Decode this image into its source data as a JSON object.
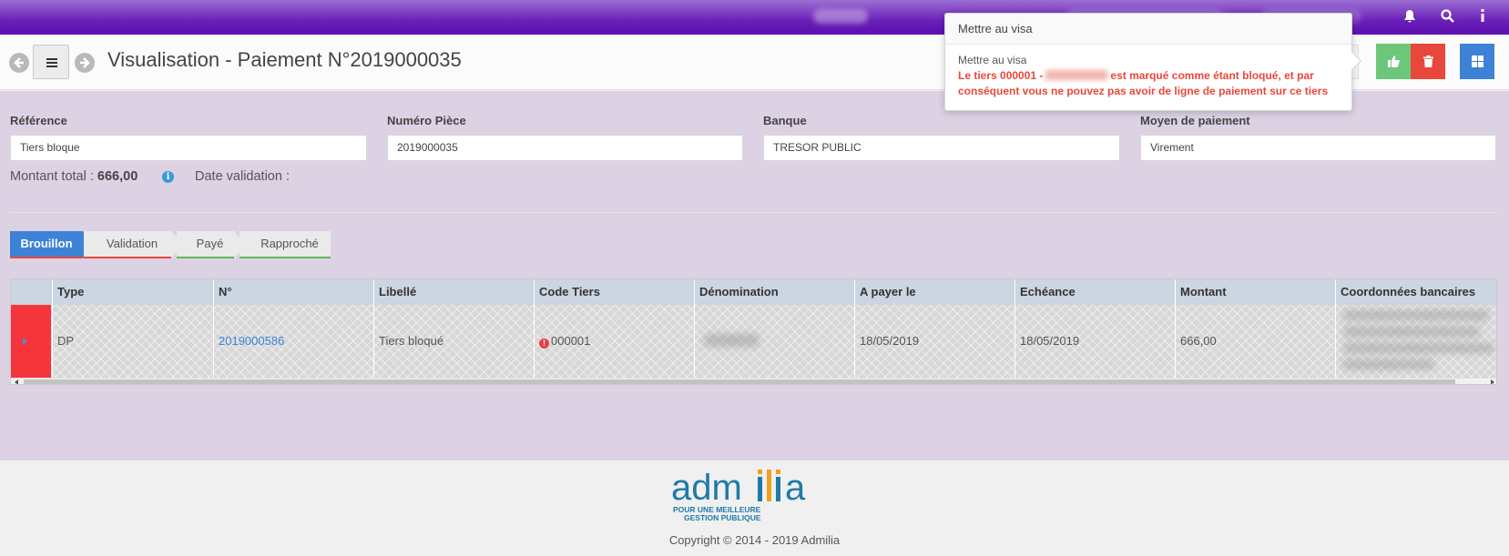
{
  "topbar": {
    "icons": [
      "bell-icon",
      "search-icon",
      "info-icon"
    ]
  },
  "header": {
    "title": "Visualisation - Paiement N°2019000035"
  },
  "popover": {
    "title": "Mettre au visa",
    "subtitle": "Mettre au visa",
    "error_prefix": "Le tiers 000001 -",
    "error_suffix": "est marqué comme étant bloqué, et par conséquent vous ne pouvez pas avoir de ligne de paiement sur ce tiers"
  },
  "form": {
    "reference_label": "Référence",
    "reference_value": "Tiers bloque",
    "numero_label": "Numéro Pièce",
    "numero_value": "2019000035",
    "banque_label": "Banque",
    "banque_value": "TRESOR PUBLIC",
    "moyen_label": "Moyen de paiement",
    "moyen_value": "Virement",
    "montant_label": "Montant total :",
    "montant_value": "666,00",
    "date_label": "Date validation :"
  },
  "steps": [
    {
      "label": "Brouillon",
      "color": "#e8473b"
    },
    {
      "label": "Validation",
      "color": "#e8473b"
    },
    {
      "label": "Payé",
      "color": "#5cb85c"
    },
    {
      "label": "Rapproché",
      "color": "#5cb85c"
    }
  ],
  "table": {
    "columns": [
      "Type",
      "N°",
      "Libellé",
      "Code Tiers",
      "Dénomination",
      "A payer le",
      "Echéance",
      "Montant",
      "Coordonnées bancaires"
    ],
    "rows": [
      {
        "type": "DP",
        "numero": "2019000586",
        "libelle": "Tiers bloqué",
        "code_tiers": "000001",
        "denomination": "",
        "a_payer_le": "18/05/2019",
        "echeance": "18/05/2019",
        "montant": "666,00",
        "coordonnees": ""
      }
    ]
  },
  "footer": {
    "logo_text": "admilia",
    "logo_tagline_1": "POUR UNE MEILLEURE",
    "logo_tagline_2": "GESTION PUBLIQUE",
    "copyright": "Copyright © 2014 - 2019 Admilia"
  },
  "colors": {
    "accent": "#3d82d6",
    "danger": "#e8473b",
    "success": "#5cb85c",
    "topbar": "#6a1fb8",
    "content_bg": "#dcd2e4"
  }
}
